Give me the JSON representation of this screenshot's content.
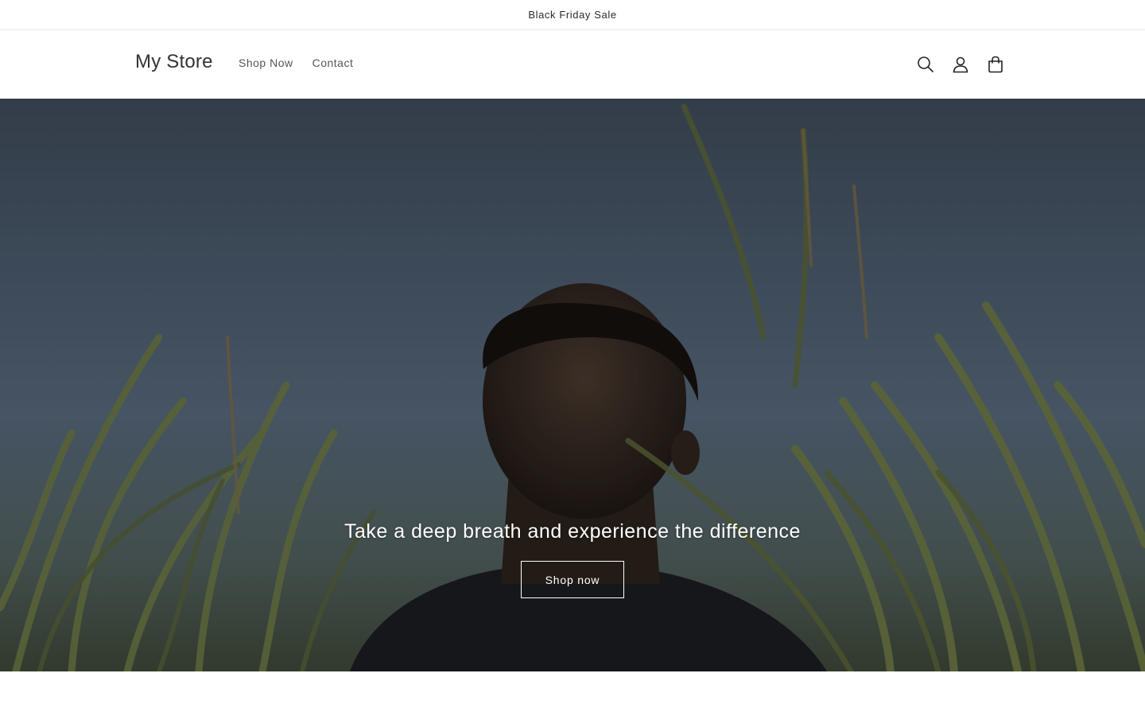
{
  "announcement": {
    "text": "Black Friday Sale"
  },
  "header": {
    "logo": "My Store",
    "nav": [
      {
        "label": "Shop Now"
      },
      {
        "label": "Contact"
      }
    ],
    "icons": [
      "search-icon",
      "account-icon",
      "cart-icon"
    ]
  },
  "hero": {
    "heading": "Take a deep breath and experience the difference",
    "button_label": "Shop now"
  },
  "colors": {
    "text": "#121212",
    "hero_sky": "#4d5d6f",
    "hero_grass": "#5a6a3c",
    "button_border": "#ffffff"
  }
}
